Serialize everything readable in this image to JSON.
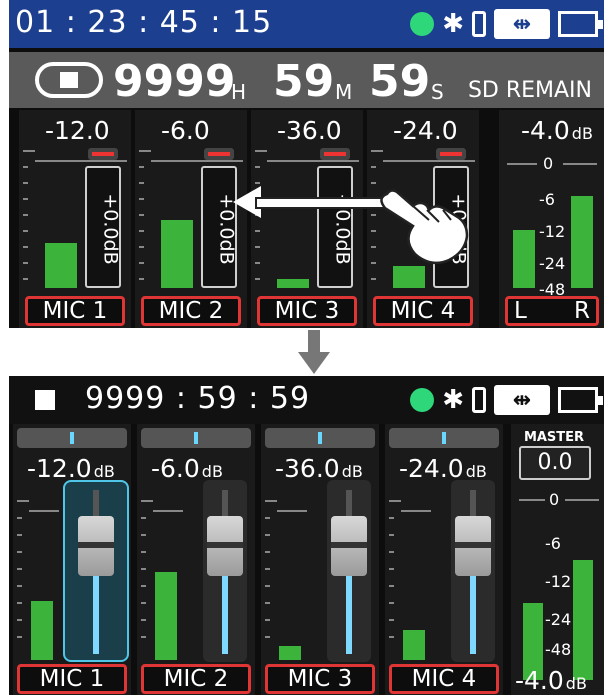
{
  "top_screen": {
    "status": {
      "timecode": "01 : 23 : 45 : 15",
      "status_dot_color": "#2ed87a",
      "bar_color": "#1d3f8f"
    },
    "remain": {
      "hours": "9999",
      "hours_unit": "H",
      "minutes": "59",
      "minutes_unit": "M",
      "seconds": "59",
      "seconds_unit": "S",
      "label": "SD REMAIN"
    },
    "channels": [
      {
        "name": "MIC 1",
        "value": "-12.0",
        "gain": "+0.0dB",
        "level": 0.35
      },
      {
        "name": "MIC 2",
        "value": "-6.0",
        "gain": "+0.0dB",
        "level": 0.53
      },
      {
        "name": "MIC 3",
        "value": "-36.0",
        "gain": "+0.0dB",
        "level": 0.07
      },
      {
        "name": "MIC 4",
        "value": "-24.0",
        "gain": "+0.0dB",
        "level": 0.17
      }
    ],
    "master": {
      "value": "-4.0",
      "unit": "dB",
      "scale": [
        "0",
        "-6",
        "-12",
        "-24",
        "-48"
      ],
      "left": "L",
      "right": "R",
      "level_l": 0.45,
      "level_r": 0.72
    }
  },
  "bottom_screen": {
    "status": {
      "stop_icon": "stop-square",
      "remain": "9999 : 59 : 59",
      "status_dot_color": "#2ed87a"
    },
    "channels": [
      {
        "name": "MIC 1",
        "value": "-12.0",
        "unit": "dB",
        "level": 0.37,
        "selected": true
      },
      {
        "name": "MIC 2",
        "value": "-6.0",
        "unit": "dB",
        "level": 0.55,
        "selected": false
      },
      {
        "name": "MIC 3",
        "value": "-36.0",
        "unit": "dB",
        "level": 0.09,
        "selected": false
      },
      {
        "name": "MIC 4",
        "value": "-24.0",
        "unit": "dB",
        "level": 0.19,
        "selected": false
      }
    ],
    "master": {
      "label": "MASTER",
      "value": "0.0",
      "db_value": "-4.0",
      "db_unit": "dB",
      "scale": [
        "0",
        "-6",
        "-12",
        "-24",
        "-48"
      ],
      "level_l": 0.48,
      "level_r": 0.75
    }
  },
  "icons": {
    "bluetooth": "✱",
    "usb": "⇹",
    "transition_arrow": "down-arrow-icon",
    "swipe": "hand-swipe-icon"
  },
  "colors": {
    "meter": "#3cb43c",
    "name_border": "#e03535",
    "fader_fill": "#7fd8ff",
    "selected_border": "#4fc6e8"
  }
}
